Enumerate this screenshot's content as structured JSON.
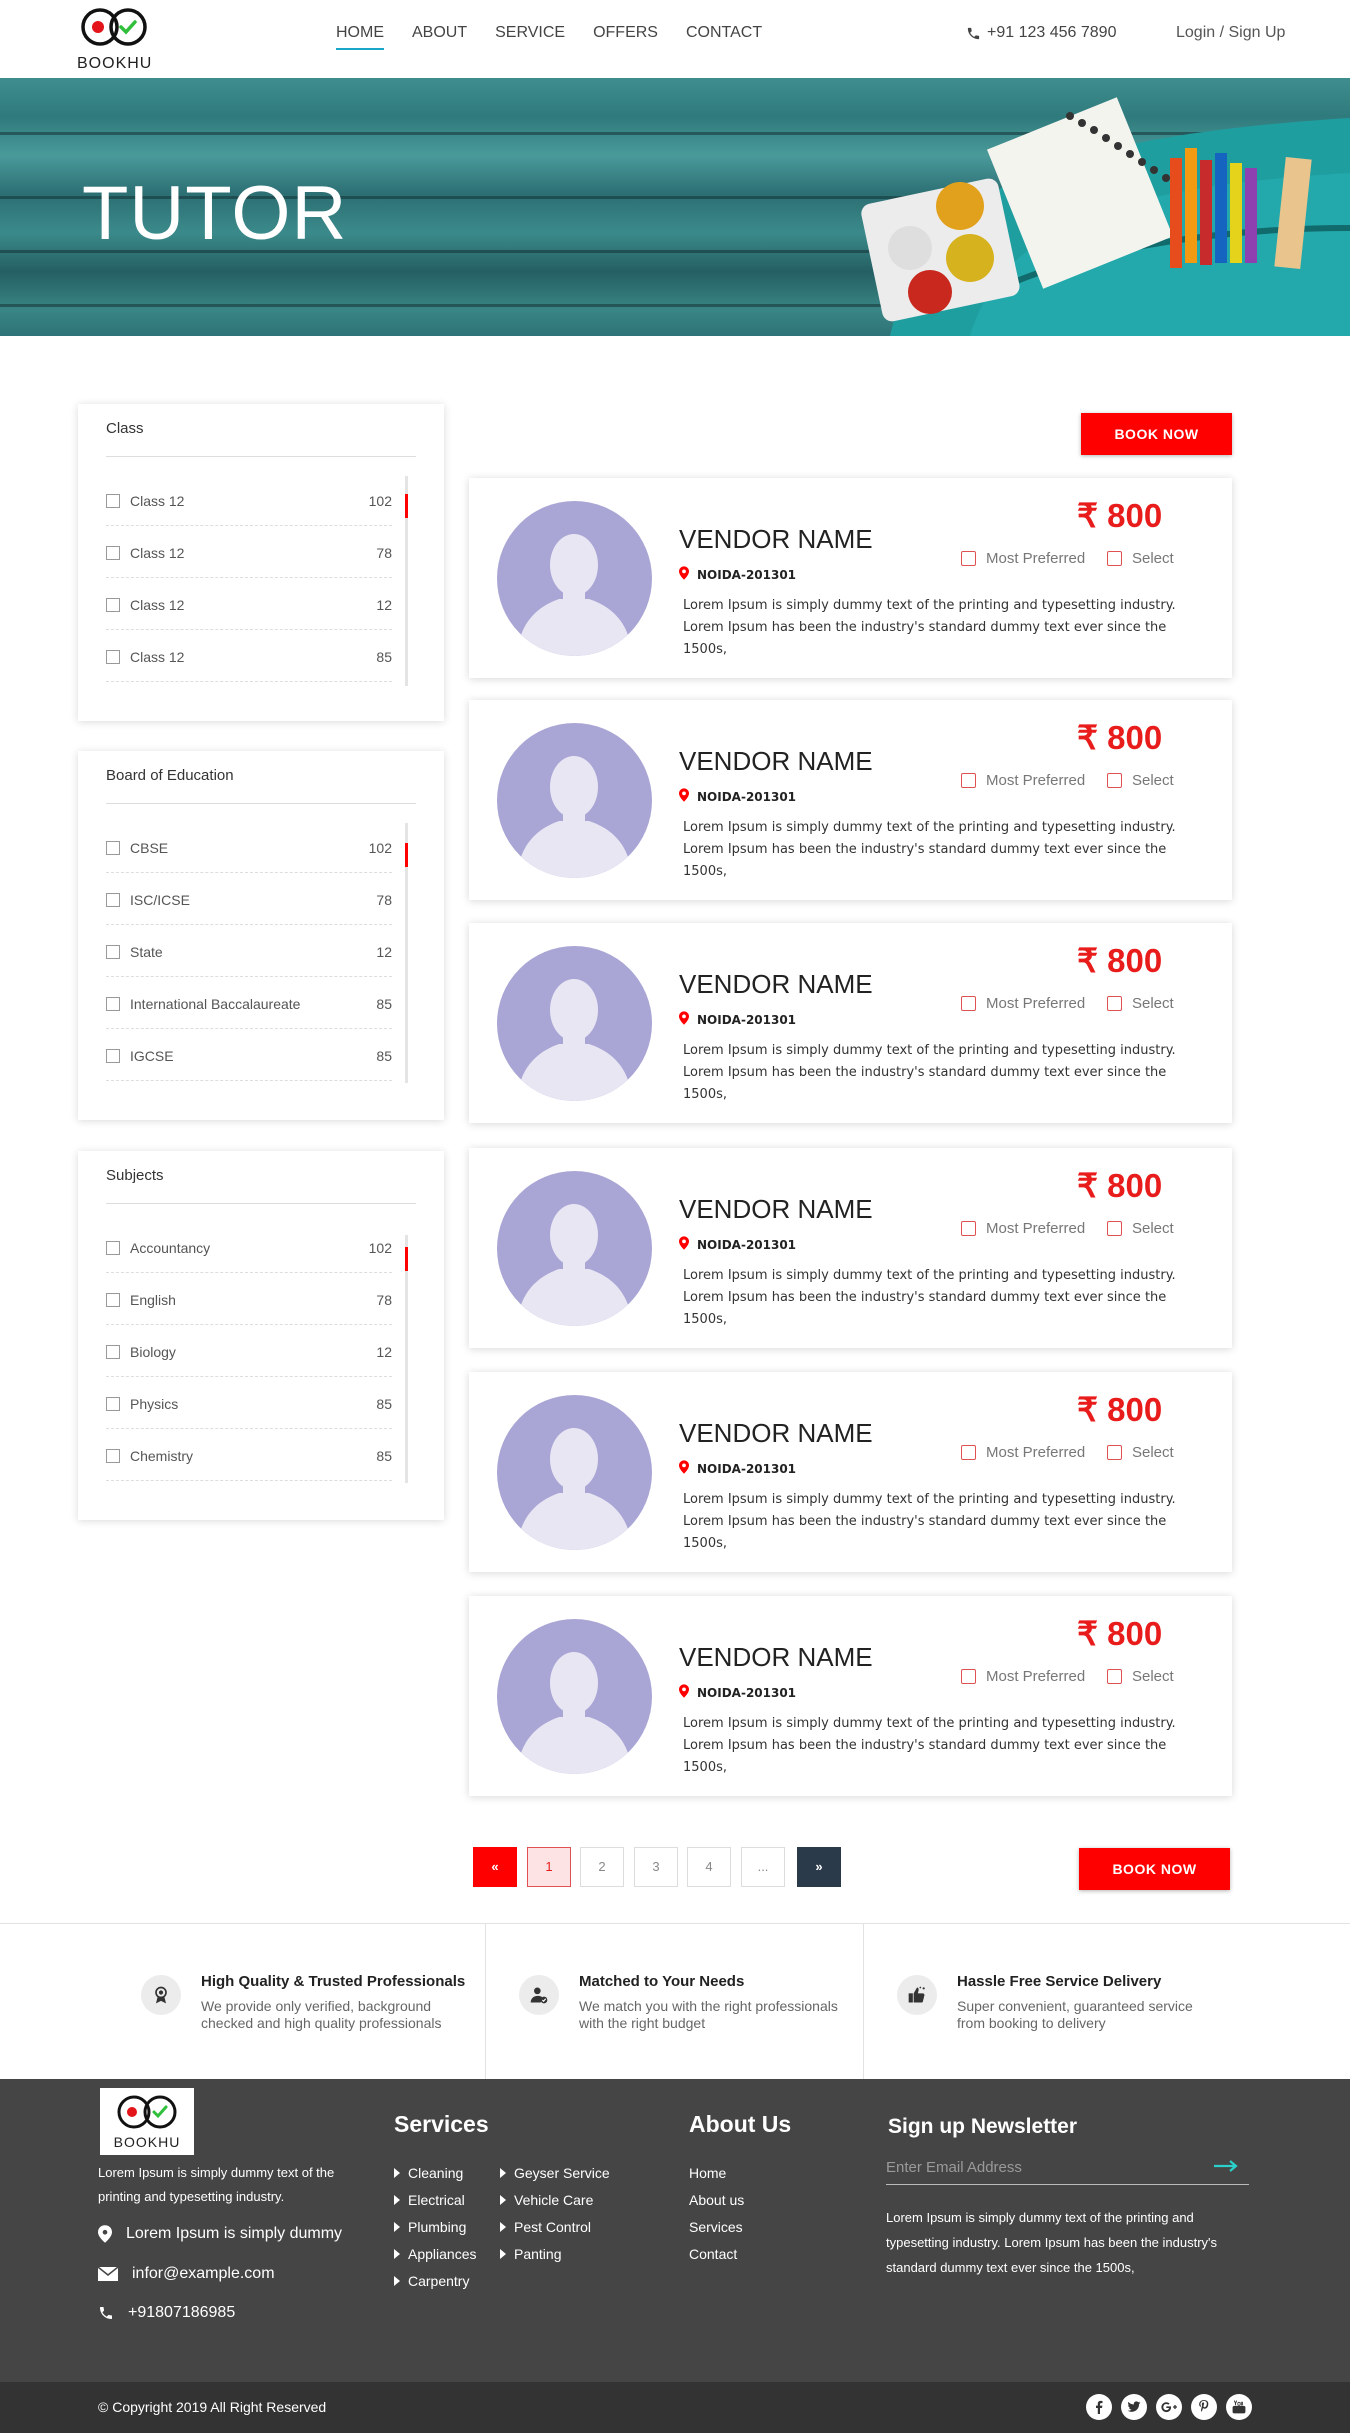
{
  "header": {
    "brand": "BOOKHU",
    "nav": [
      "HOME",
      "ABOUT",
      "SERVICE",
      "OFFERS",
      "CONTACT"
    ],
    "active_nav": "HOME",
    "phone": "+91 123 456 7890",
    "login": "Login / Sign Up"
  },
  "hero": {
    "title": "TUTOR"
  },
  "filters": [
    {
      "title": "Class",
      "items": [
        {
          "label": "Class 12",
          "count": "102"
        },
        {
          "label": "Class 12",
          "count": "78"
        },
        {
          "label": "Class 12",
          "count": "12"
        },
        {
          "label": "Class 12",
          "count": "85"
        }
      ]
    },
    {
      "title": "Board of Education",
      "items": [
        {
          "label": "CBSE",
          "count": "102"
        },
        {
          "label": "ISC/ICSE",
          "count": "78"
        },
        {
          "label": "State",
          "count": "12"
        },
        {
          "label": "International Baccalaureate",
          "count": "85"
        },
        {
          "label": "IGCSE",
          "count": "85"
        }
      ]
    },
    {
      "title": "Subjects",
      "items": [
        {
          "label": "Accountancy",
          "count": "102"
        },
        {
          "label": "English",
          "count": "78"
        },
        {
          "label": "Biology",
          "count": "12"
        },
        {
          "label": "Physics",
          "count": "85"
        },
        {
          "label": "Chemistry",
          "count": "85"
        }
      ]
    }
  ],
  "book_now": "BOOK NOW",
  "vendors": [
    {
      "name": "VENDOR NAME",
      "location": "NOIDA-201301",
      "price": "₹ 800",
      "most_preferred": "Most Preferred",
      "select": "Select",
      "description": "Lorem Ipsum is simply dummy text of the printing and typesetting industry. Lorem Ipsum has been the industry's standard dummy text ever since the 1500s,"
    },
    {
      "name": "VENDOR NAME",
      "location": "NOIDA-201301",
      "price": "₹ 800",
      "most_preferred": "Most Preferred",
      "select": "Select",
      "description": "Lorem Ipsum is simply dummy text of the printing and typesetting industry. Lorem Ipsum has been the industry's standard dummy text ever since the 1500s,"
    },
    {
      "name": "VENDOR NAME",
      "location": "NOIDA-201301",
      "price": "₹ 800",
      "most_preferred": "Most Preferred",
      "select": "Select",
      "description": "Lorem Ipsum is simply dummy text of the printing and typesetting industry. Lorem Ipsum has been the industry's standard dummy text ever since the 1500s,"
    },
    {
      "name": "VENDOR NAME",
      "location": "NOIDA-201301",
      "price": "₹ 800",
      "most_preferred": "Most Preferred",
      "select": "Select",
      "description": "Lorem Ipsum is simply dummy text of the printing and typesetting industry. Lorem Ipsum has been the industry's standard dummy text ever since the 1500s,"
    },
    {
      "name": "VENDOR NAME",
      "location": "NOIDA-201301",
      "price": "₹ 800",
      "most_preferred": "Most Preferred",
      "select": "Select",
      "description": "Lorem Ipsum is simply dummy text of the printing and typesetting industry. Lorem Ipsum has been the industry's standard dummy text ever since the 1500s,"
    },
    {
      "name": "VENDOR NAME",
      "location": "NOIDA-201301",
      "price": "₹ 800",
      "most_preferred": "Most Preferred",
      "select": "Select",
      "description": "Lorem Ipsum is simply dummy text of the printing and typesetting industry. Lorem Ipsum has been the industry's standard dummy text ever since the 1500s,"
    }
  ],
  "pagination": {
    "prev": "«",
    "pages": [
      "1",
      "2",
      "3",
      "4"
    ],
    "ellipsis": "...",
    "next": "»",
    "current": "1"
  },
  "features": [
    {
      "title": "High Quality & Trusted Professionals",
      "text": "We provide only verified, background checked and high quality professionals",
      "icon": "award-icon"
    },
    {
      "title": "Matched to Your Needs",
      "text": "We match you with the right professionals with the right budget",
      "icon": "user-check-icon"
    },
    {
      "title": "Hassle Free Service Delivery",
      "text": "Super convenient, guaranteed service from booking to delivery",
      "icon": "thumbs-up-icon"
    }
  ],
  "footer": {
    "about": "Lorem Ipsum is simply dummy text of the printing and typesetting industry.",
    "address": "Lorem Ipsum is simply dummy",
    "email": "infor@example.com",
    "phone": "+91807186985",
    "services_title": "Services",
    "services_col1": [
      "Cleaning",
      "Electrical",
      "Plumbing",
      "Appliances",
      "Carpentry"
    ],
    "services_col2": [
      "Geyser Service",
      "Vehicle Care",
      "Pest Control",
      "Panting"
    ],
    "about_title": "About Us",
    "about_links": [
      "Home",
      "About us",
      "Services",
      "Contact"
    ],
    "newsletter_title": "Sign up Newsletter",
    "newsletter_placeholder": "Enter Email Address",
    "newsletter_text": "Lorem Ipsum is simply dummy text of the printing and typesetting industry. Lorem Ipsum has been the industry's standard dummy text ever since the 1500s,",
    "copyright": "© Copyright 2019  All Right Reserved",
    "social": [
      "facebook-icon",
      "twitter-icon",
      "google-plus-icon",
      "pinterest-icon",
      "youtube-icon"
    ]
  },
  "colors": {
    "accent_red": "#ff0000",
    "price_red": "#e91c1c",
    "nav_underline": "#19a6c8",
    "footer_bg": "#454545",
    "avatar": "#a9a6d5"
  }
}
